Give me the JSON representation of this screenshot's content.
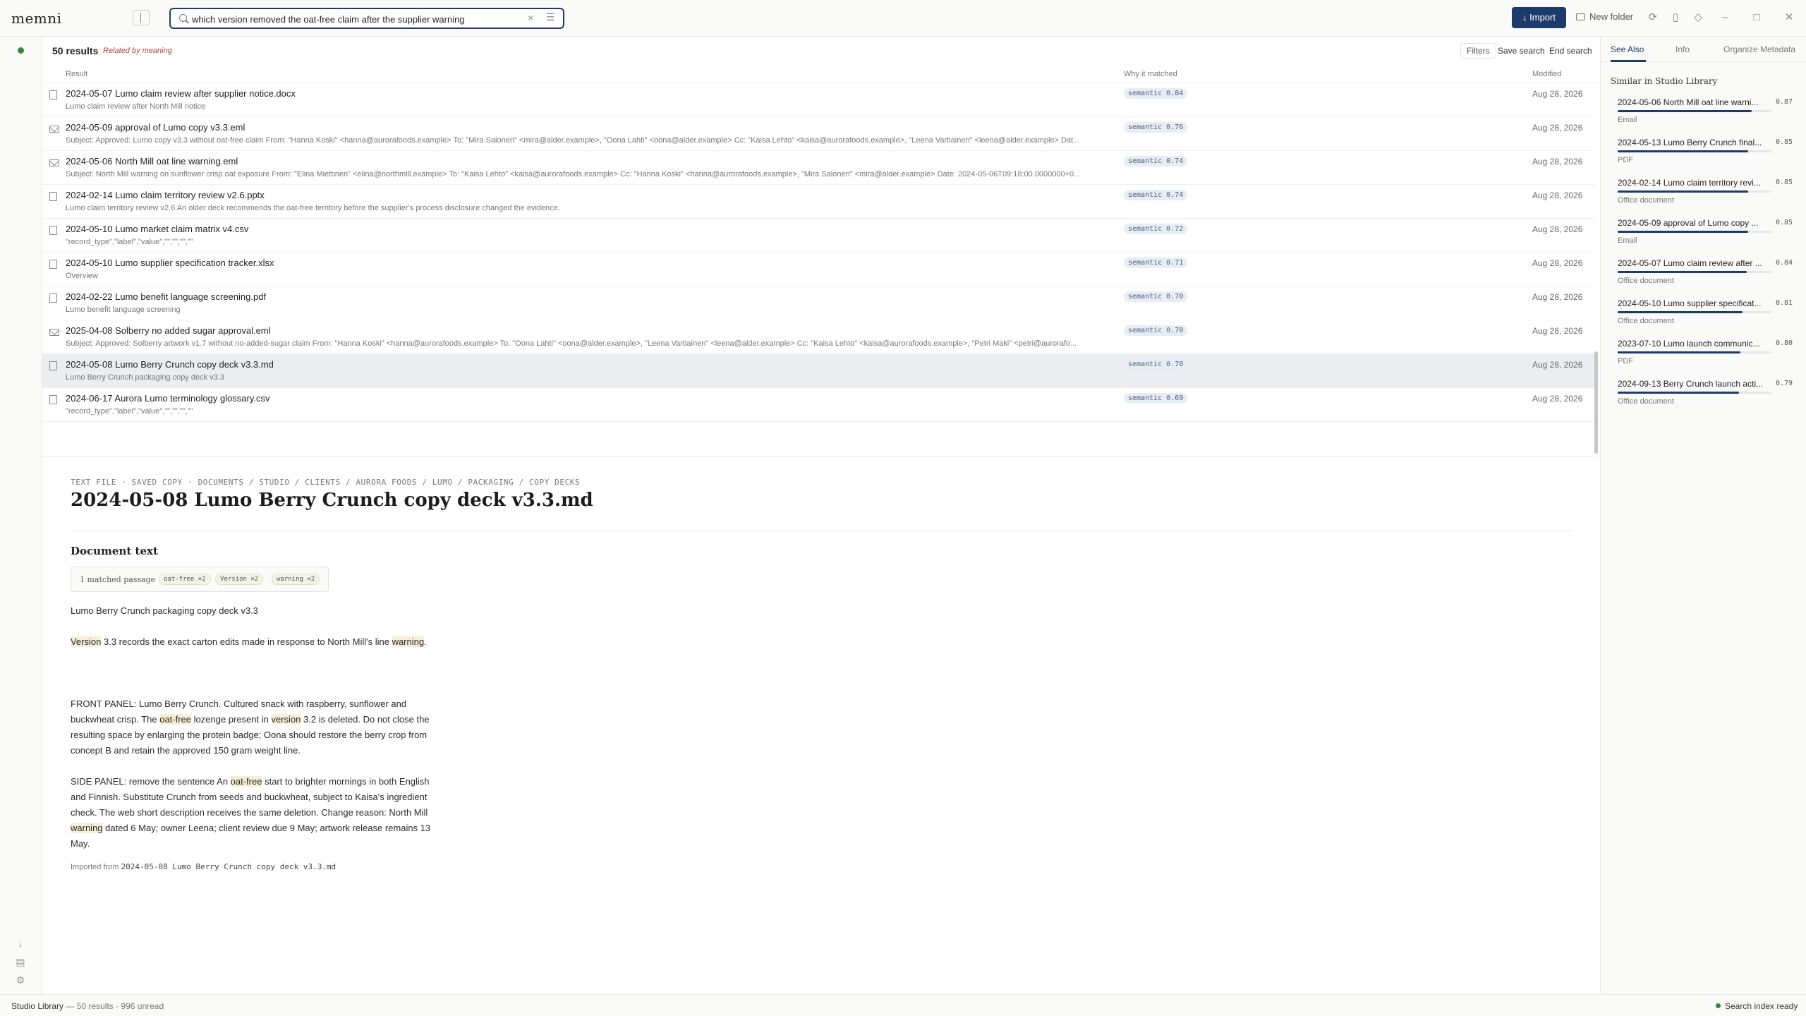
{
  "app": {
    "name": "memni"
  },
  "search": {
    "query": "which version removed the oat-free claim after the supplier warning"
  },
  "toolbar": {
    "import_label": "Import",
    "new_folder_label": "New folder"
  },
  "results": {
    "count_label": "50 results",
    "mode_label": "Related by meaning",
    "filters_label": "Filters",
    "save_search_label": "Save search",
    "end_search_label": "End search",
    "columns": {
      "result": "Result",
      "why": "Why it matched",
      "modified": "Modified"
    },
    "rows": [
      {
        "icon": "document-icon",
        "title": "2024-05-07 Lumo claim review after supplier notice.docx",
        "subtitle": "Lumo claim review after North Mill notice",
        "match": "semantic 0.84",
        "modified": "Aug 28, 2026"
      },
      {
        "icon": "mail-icon",
        "title": "2024-05-09 approval of Lumo copy v3.3.eml",
        "subtitle": "Subject: Approved: Lumo copy v3.3 without oat-free claim From: \"Hanna Koski\" <hanna@aurorafoods.example> To: \"Mira Salonen\" <mira@alder.example>, \"Oona Lahti\" <oona@alder.example> Cc: \"Kaisa Lehto\" <kaisa@aurorafoods.example>, \"Leena Vartiainen\" <leena@alder.example> Dat...",
        "match": "semantic 0.76",
        "modified": "Aug 28, 2026"
      },
      {
        "icon": "mail-icon",
        "title": "2024-05-06 North Mill oat line warning.eml",
        "subtitle": "Subject: North Mill warning on sunflower crisp oat exposure From: \"Elina Miettinen\" <elina@northmill.example> To: \"Kaisa Lehto\" <kaisa@aurorafoods.example> Cc: \"Hanna Koski\" <hanna@aurorafoods.example>, \"Mira Salonen\" <mira@alder.example> Date: 2024-05-06T09:18:00.0000000+0...",
        "match": "semantic 0.74",
        "modified": "Aug 28, 2026"
      },
      {
        "icon": "document-icon",
        "title": "2024-02-14 Lumo claim territory review v2.6.pptx",
        "subtitle": "Lumo claim territory review v2.6 An older deck recommends the oat-free territory before the supplier's process disclosure changed the evidence.",
        "match": "semantic 0.74",
        "modified": "Aug 28, 2026"
      },
      {
        "icon": "document-icon",
        "title": "2024-05-10 Lumo market claim matrix v4.csv",
        "subtitle": "\"record_type\",\"label\",\"value\",\"\",\"\",\"\",\"\"",
        "match": "semantic 0.72",
        "modified": "Aug 28, 2026"
      },
      {
        "icon": "document-icon",
        "title": "2024-05-10 Lumo supplier specification tracker.xlsx",
        "subtitle": "Overview",
        "match": "semantic 0.71",
        "modified": "Aug 28, 2026"
      },
      {
        "icon": "document-icon",
        "title": "2024-02-22 Lumo benefit language screening.pdf",
        "subtitle": "Lumo benefit language screening",
        "match": "semantic 0.70",
        "modified": "Aug 28, 2026"
      },
      {
        "icon": "mail-icon",
        "title": "2025-04-08 Solberry no added sugar approval.eml",
        "subtitle": "Subject: Approved: Solberry artwork v1.7 without no-added-sugar claim From: \"Hanna Koski\" <hanna@aurorafoods.example> To: \"Oona Lahti\" <oona@alder.example>, \"Leena Vartiainen\" <leena@alder.example> Cc: \"Kaisa Lehto\" <kaisa@aurorafoods.example>, \"Petri Maki\" <petri@aurorafo...",
        "match": "semantic 0.70",
        "modified": "Aug 28, 2026"
      },
      {
        "icon": "document-icon",
        "title": "2024-05-08 Lumo Berry Crunch copy deck v3.3.md",
        "subtitle": "Lumo Berry Crunch packaging copy deck v3.3",
        "match": "semantic 0.70",
        "modified": "Aug 28, 2026",
        "selected": true
      },
      {
        "icon": "document-icon",
        "title": "2024-06-17 Aurora Lumo terminology glossary.csv",
        "subtitle": "\"record_type\",\"label\",\"value\",\"\",\"\",\"\",\"\"",
        "match": "semantic 0.69",
        "modified": "Aug 28, 2026"
      }
    ]
  },
  "document": {
    "breadcrumb": "TEXT FILE · SAVED COPY · DOCUMENTS / STUDIO / CLIENTS / AURORA FOODS / LUMO / PACKAGING / COPY DECKS",
    "title": "2024-05-08 Lumo Berry Crunch copy deck v3.3.md",
    "section_heading": "Document text",
    "matched_label": "1 matched passage",
    "chips": [
      "oat-free ×2",
      "Version ×2",
      "warning ×2"
    ],
    "paragraphs": [
      [
        {
          "t": "Lumo Berry Crunch packaging copy deck v3.3"
        }
      ],
      [
        {
          "t": "Version",
          "h": true
        },
        {
          "t": " 3.3 records the exact carton edits made in response to North Mill's line "
        },
        {
          "t": "warning",
          "h": true
        },
        {
          "t": "."
        }
      ],
      [
        {
          "t": "FRONT PANEL: Lumo Berry Crunch. Cultured snack with raspberry, sunflower and buckwheat crisp. The "
        },
        {
          "t": "oat-free",
          "h": true
        },
        {
          "t": " lozenge present in "
        },
        {
          "t": "version",
          "h": true
        },
        {
          "t": " 3.2 is deleted. Do not close the resulting space by enlarging the protein badge; Oona should restore the berry crop from concept B and retain the approved 150 gram weight line."
        }
      ],
      [
        {
          "t": "SIDE PANEL: remove the sentence An "
        },
        {
          "t": "oat-free",
          "h": true
        },
        {
          "t": " start to brighter mornings in both English and Finnish. Substitute Crunch from seeds and buckwheat, subject to Kaisa's ingredient check. The web short description receives the same deletion. Change reason: North Mill "
        },
        {
          "t": "warning",
          "h": true
        },
        {
          "t": " dated 6 May; owner Leena; client review due 9 May; artwork release remains 13 May."
        }
      ]
    ],
    "imported_prefix": "Imported from",
    "imported_file": "2024-05-08 Lumo Berry Crunch copy deck v3.3.md"
  },
  "right_panel": {
    "tabs": [
      "See Also",
      "Info",
      "Organize",
      "Metadata"
    ],
    "active_tab": "See Also",
    "similar_heading": "Similar in Studio Library",
    "similar": [
      {
        "title": "2024-05-06 North Mill oat line warni...",
        "score": "0.87",
        "value": 0.87,
        "kind": "Email"
      },
      {
        "title": "2024-05-13 Lumo Berry Crunch final...",
        "score": "0.85",
        "value": 0.85,
        "kind": "PDF"
      },
      {
        "title": "2024-02-14 Lumo claim territory revi...",
        "score": "0.85",
        "value": 0.85,
        "kind": "Office document"
      },
      {
        "title": "2024-05-09 approval of Lumo copy ...",
        "score": "0.85",
        "value": 0.85,
        "kind": "Email"
      },
      {
        "title": "2024-05-07 Lumo claim review after ...",
        "score": "0.84",
        "value": 0.84,
        "kind": "Office document"
      },
      {
        "title": "2024-05-10 Lumo supplier specificat...",
        "score": "0.81",
        "value": 0.81,
        "kind": "Office document"
      },
      {
        "title": "2023-07-10 Lumo launch communic...",
        "score": "0.80",
        "value": 0.8,
        "kind": "PDF"
      },
      {
        "title": "2024-09-13 Berry Crunch launch acti...",
        "score": "0.79",
        "value": 0.79,
        "kind": "Office document"
      }
    ]
  },
  "status": {
    "library": "Studio Library",
    "summary": "— 50 results · 996 unread",
    "index_status": "Search index ready"
  },
  "colors": {
    "accent": "#1d3a6b",
    "highlight": "#f6eed5",
    "ready": "#2f8a3e",
    "mode_label": "#b0433b"
  }
}
